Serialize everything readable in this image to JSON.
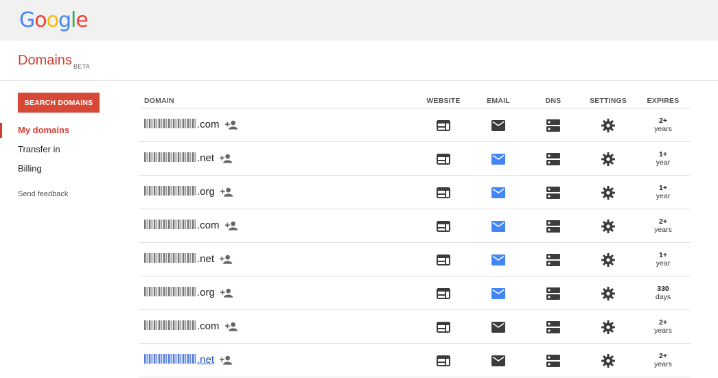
{
  "brand": {
    "logo_letters": [
      {
        "char": "G",
        "color": "#4285F4"
      },
      {
        "char": "o",
        "color": "#EA4335"
      },
      {
        "char": "o",
        "color": "#FBBC05"
      },
      {
        "char": "g",
        "color": "#4285F4"
      },
      {
        "char": "l",
        "color": "#34A853"
      },
      {
        "char": "e",
        "color": "#EA4335"
      }
    ]
  },
  "header": {
    "title": "Domains",
    "badge": "BETA"
  },
  "sidebar": {
    "search_button": "SEARCH DOMAINS",
    "items": [
      {
        "label": "My domains",
        "active": true
      },
      {
        "label": "Transfer in",
        "active": false
      },
      {
        "label": "Billing",
        "active": false
      }
    ],
    "feedback": "Send feedback"
  },
  "table": {
    "columns": [
      "DOMAIN",
      "WEBSITE",
      "EMAIL",
      "DNS",
      "SETTINGS",
      "EXPIRES"
    ],
    "rows": [
      {
        "tld": ".com",
        "email_active": false,
        "expires_value": "2+",
        "expires_unit": "years",
        "link": false
      },
      {
        "tld": ".net",
        "email_active": true,
        "expires_value": "1+",
        "expires_unit": "year",
        "link": false
      },
      {
        "tld": ".org",
        "email_active": true,
        "expires_value": "1+",
        "expires_unit": "year",
        "link": false
      },
      {
        "tld": ".com",
        "email_active": true,
        "expires_value": "2+",
        "expires_unit": "years",
        "link": false
      },
      {
        "tld": ".net",
        "email_active": true,
        "expires_value": "1+",
        "expires_unit": "year",
        "link": false
      },
      {
        "tld": ".org",
        "email_active": true,
        "expires_value": "330",
        "expires_unit": "days",
        "link": false
      },
      {
        "tld": ".com",
        "email_active": false,
        "expires_value": "2+",
        "expires_unit": "years",
        "link": false
      },
      {
        "tld": ".net",
        "email_active": false,
        "expires_value": "2+",
        "expires_unit": "years",
        "link": true
      }
    ]
  },
  "colors": {
    "accent": "#d23f31",
    "button": "#d74836",
    "email_active": "#4285F4",
    "icon_default": "#3c3c3c",
    "link": "#1a4fc4"
  },
  "icons": {
    "add_user": "person-add-icon",
    "website": "web-icon",
    "email": "mail-icon",
    "dns": "dns-icon",
    "settings": "gear-icon"
  }
}
